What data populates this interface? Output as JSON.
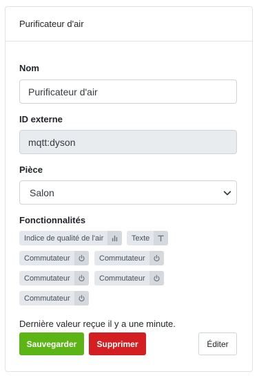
{
  "header": {
    "title": "Purificateur d'air"
  },
  "form": {
    "name_label": "Nom",
    "name_value": "Purificateur d'air",
    "external_id_label": "ID externe",
    "external_id_value": "mqtt:dyson",
    "room_label": "Pièce",
    "room_value": "Salon",
    "features_label": "Fonctionnalités"
  },
  "features": [
    {
      "label": "Indice de qualité de l'air",
      "icon": "bar-chart-icon"
    },
    {
      "label": "Texte",
      "icon": "text-icon"
    },
    {
      "label": "Commutateur",
      "icon": "power-icon"
    },
    {
      "label": "Commutateur",
      "icon": "power-icon"
    },
    {
      "label": "Commutateur",
      "icon": "power-icon"
    },
    {
      "label": "Commutateur",
      "icon": "power-icon"
    },
    {
      "label": "Commutateur",
      "icon": "power-icon"
    }
  ],
  "status": {
    "last_value": "Dernière valeur reçue il y a une minute."
  },
  "buttons": {
    "save": "Sauvegarder",
    "delete": "Supprimer",
    "edit": "Éditer"
  },
  "colors": {
    "save": "#5cb415",
    "delete": "#d31f22",
    "tag_bg": "#e4e7eb"
  }
}
